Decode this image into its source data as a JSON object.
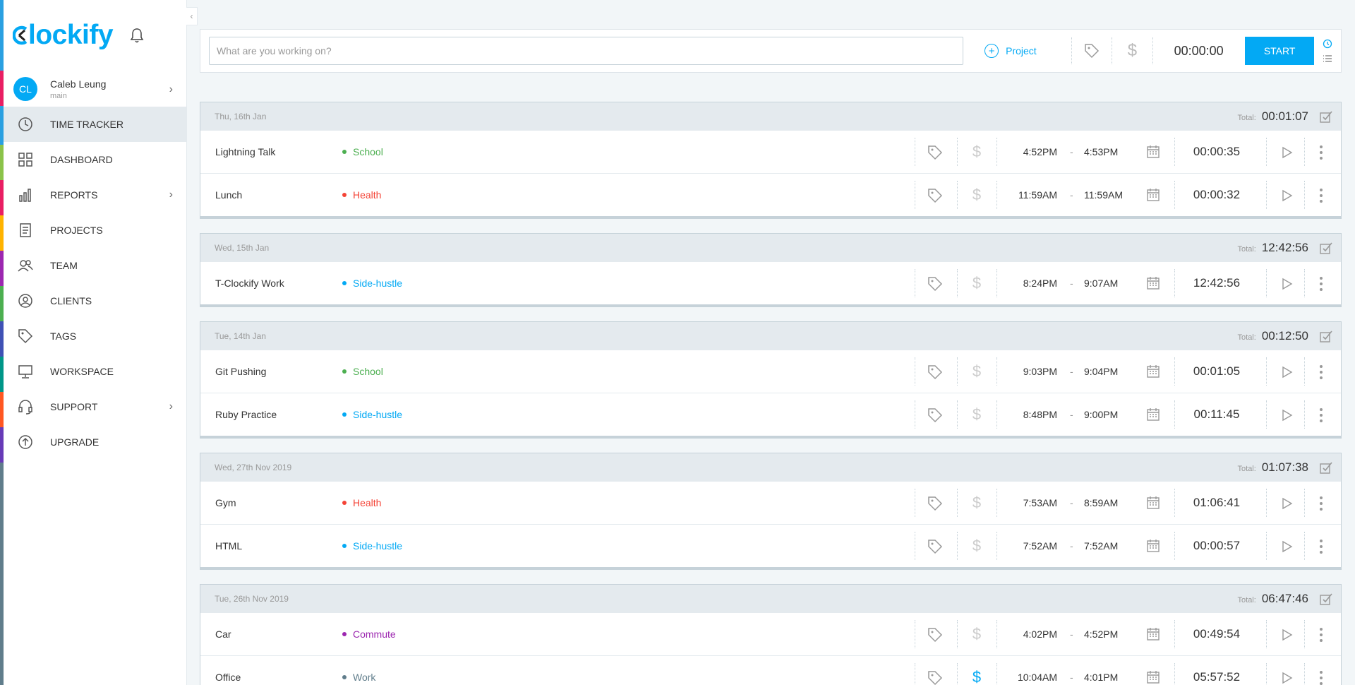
{
  "app": {
    "name": "Clockify",
    "logo_text": "lockify",
    "brand_color": "#03a9f4"
  },
  "user": {
    "initials": "CL",
    "name": "Caleb Leung",
    "workspace": "main"
  },
  "sidebar": {
    "items": [
      {
        "label": "Time tracker",
        "icon": "clock-icon",
        "active": true
      },
      {
        "label": "Dashboard",
        "icon": "dashboard-icon"
      },
      {
        "label": "Reports",
        "icon": "bar-chart-icon",
        "has_submenu": true
      },
      {
        "label": "Projects",
        "icon": "document-icon"
      },
      {
        "label": "Team",
        "icon": "users-icon"
      },
      {
        "label": "Clients",
        "icon": "user-circle-icon"
      },
      {
        "label": "Tags",
        "icon": "tag-icon"
      },
      {
        "label": "Workspace",
        "icon": "monitor-icon"
      },
      {
        "label": "Support",
        "icon": "headset-icon",
        "has_submenu": true
      },
      {
        "label": "Upgrade",
        "icon": "arrow-up-circle-icon"
      }
    ]
  },
  "timer": {
    "placeholder": "What are you working on?",
    "project_label": "Project",
    "time": "00:00:00",
    "start_label": "Start"
  },
  "groups": [
    {
      "date": "Thu, 16th Jan",
      "total_label": "Total:",
      "total": "00:01:07",
      "entries": [
        {
          "desc": "Lightning Talk",
          "project": "School",
          "color": "#4caf50",
          "start": "4:52PM",
          "end": "4:53PM",
          "duration": "00:00:35",
          "billable": false
        },
        {
          "desc": "Lunch",
          "project": "Health",
          "color": "#f44336",
          "start": "11:59AM",
          "end": "11:59AM",
          "duration": "00:00:32",
          "billable": false
        }
      ]
    },
    {
      "date": "Wed, 15th Jan",
      "total_label": "Total:",
      "total": "12:42:56",
      "entries": [
        {
          "desc": "T-Clockify Work",
          "project": "Side-hustle",
          "color": "#03a9f4",
          "start": "8:24PM",
          "end": "9:07AM",
          "duration": "12:42:56",
          "billable": false
        }
      ]
    },
    {
      "date": "Tue, 14th Jan",
      "total_label": "Total:",
      "total": "00:12:50",
      "entries": [
        {
          "desc": "Git Pushing",
          "project": "School",
          "color": "#4caf50",
          "start": "9:03PM",
          "end": "9:04PM",
          "duration": "00:01:05",
          "billable": false
        },
        {
          "desc": "Ruby Practice",
          "project": "Side-hustle",
          "color": "#03a9f4",
          "start": "8:48PM",
          "end": "9:00PM",
          "duration": "00:11:45",
          "billable": false
        }
      ]
    },
    {
      "date": "Wed, 27th Nov 2019",
      "total_label": "Total:",
      "total": "01:07:38",
      "entries": [
        {
          "desc": "Gym",
          "project": "Health",
          "color": "#f44336",
          "start": "7:53AM",
          "end": "8:59AM",
          "duration": "01:06:41",
          "billable": false
        },
        {
          "desc": "HTML",
          "project": "Side-hustle",
          "color": "#03a9f4",
          "start": "7:52AM",
          "end": "7:52AM",
          "duration": "00:00:57",
          "billable": false
        }
      ]
    },
    {
      "date": "Tue, 26th Nov 2019",
      "total_label": "Total:",
      "total": "06:47:46",
      "entries": [
        {
          "desc": "Car",
          "project": "Commute",
          "color": "#9c27b0",
          "start": "4:02PM",
          "end": "4:52PM",
          "duration": "00:49:54",
          "billable": false
        },
        {
          "desc": "Office",
          "project": "Work",
          "color": "#607d8b",
          "start": "10:04AM",
          "end": "4:01PM",
          "duration": "05:57:52",
          "billable": true
        }
      ]
    }
  ]
}
